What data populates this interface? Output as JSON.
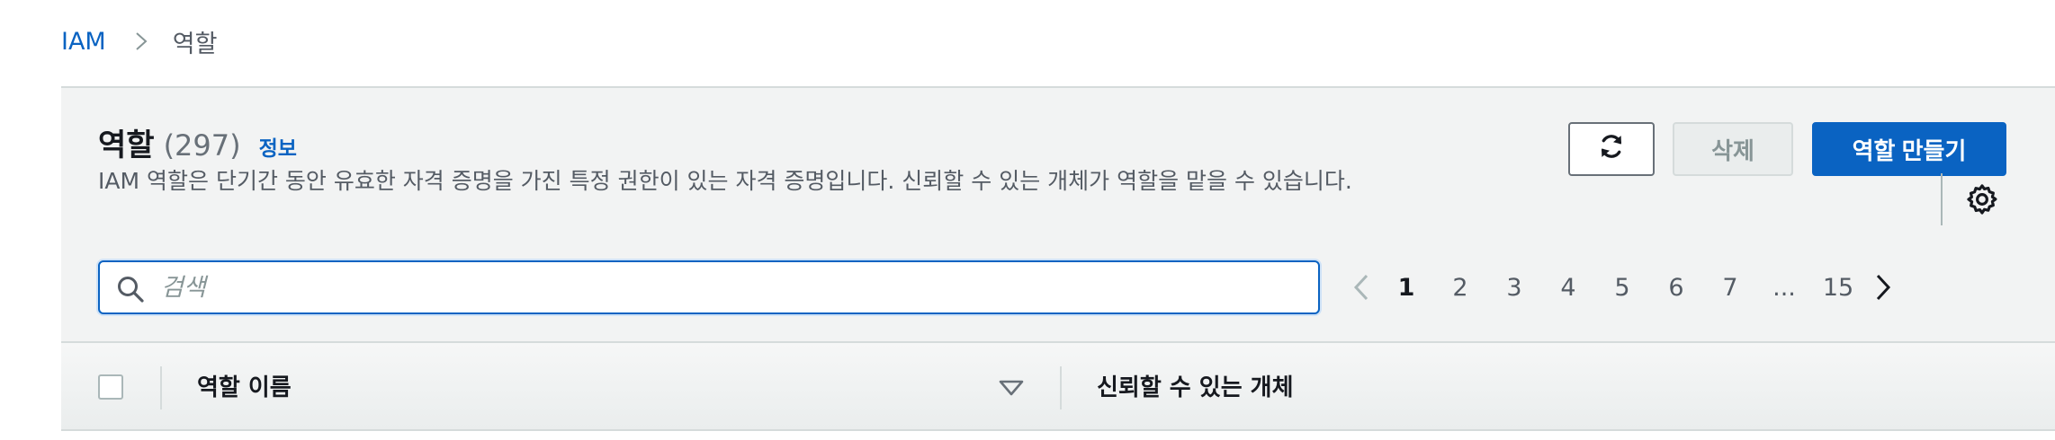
{
  "breadcrumb": {
    "root": "IAM",
    "current": "역할"
  },
  "header": {
    "title": "역할",
    "count": "(297)",
    "info_link": "정보",
    "description": "IAM 역할은 단기간 동안 유효한 자격 증명을 가진 특정 권한이 있는 자격 증명입니다. 신뢰할 수 있는 개체가 역할을 맡을 수 있습니다."
  },
  "actions": {
    "refresh_icon": "refresh-icon",
    "delete_label": "삭제",
    "create_label": "역할 만들기"
  },
  "search": {
    "placeholder": "검색",
    "value": ""
  },
  "pagination": {
    "current_page": 1,
    "pages": [
      "1",
      "2",
      "3",
      "4",
      "5",
      "6",
      "7",
      "...",
      "15"
    ]
  },
  "table": {
    "columns": [
      "역할 이름",
      "신뢰할 수 있는 개체"
    ]
  },
  "colors": {
    "accent": "#0a63c2",
    "panel_bg": "#f2f3f3",
    "muted_text": "#545b64",
    "border": "#d5dbdb"
  }
}
